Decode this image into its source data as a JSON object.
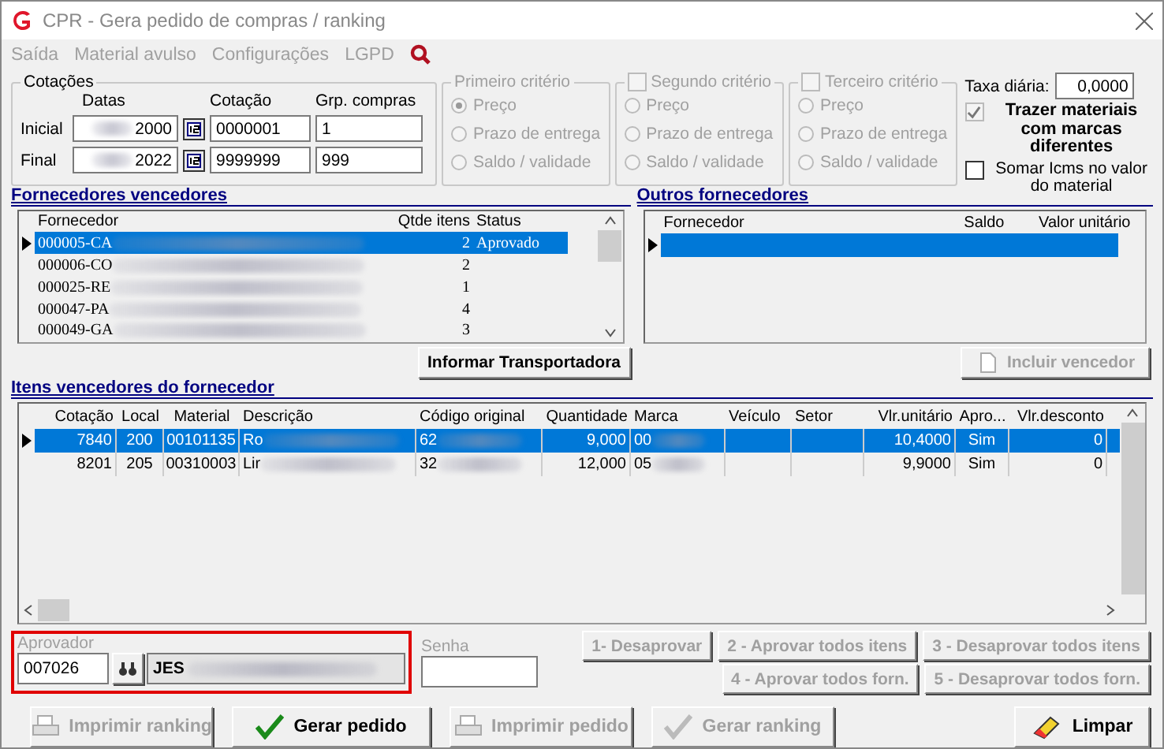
{
  "window": {
    "title": "CPR - Gera pedido de compras / ranking"
  },
  "menu": [
    {
      "label": "Saída",
      "disabled": true
    },
    {
      "label": "Material avulso",
      "disabled": true
    },
    {
      "label": "Configurações",
      "disabled": true
    },
    {
      "label": "LGPD",
      "disabled": true
    }
  ],
  "cotacoes": {
    "title": "Cotações",
    "headers": [
      "Datas",
      "Cotação",
      "Grp. compras"
    ],
    "rows": [
      {
        "label": "Inicial",
        "date": "2000",
        "cotacao": "0000001",
        "grupo": "1"
      },
      {
        "label": "Final",
        "date": "2022",
        "cotacao": "9999999",
        "grupo": "999"
      }
    ]
  },
  "criteria": [
    {
      "kind": "plain",
      "title": "Primeiro critério",
      "options": [
        {
          "label": "Preço",
          "selected": true
        },
        {
          "label": "Prazo de entrega",
          "selected": false
        },
        {
          "label": "Saldo / validade",
          "selected": false
        }
      ]
    },
    {
      "kind": "checkbox",
      "title": "Segundo critério",
      "checked": false,
      "options": [
        {
          "label": "Preço",
          "selected": false
        },
        {
          "label": "Prazo de entrega",
          "selected": false
        },
        {
          "label": "Saldo / validade",
          "selected": false
        }
      ]
    },
    {
      "kind": "checkbox",
      "title": "Terceiro critério",
      "checked": false,
      "options": [
        {
          "label": "Preço",
          "selected": false
        },
        {
          "label": "Prazo de entrega",
          "selected": false
        },
        {
          "label": "Saldo / validade",
          "selected": false
        }
      ]
    }
  ],
  "taxa": {
    "label": "Taxa diária:",
    "value": "0,0000"
  },
  "options": [
    {
      "label": "Trazer materiais com marcas diferentes",
      "checked": true,
      "disabled": true
    },
    {
      "label": "Somar Icms no valor do material",
      "checked": false,
      "disabled": false
    }
  ],
  "winners": {
    "title": "Fornecedores vencedores",
    "columns": [
      "Fornecedor",
      "Qtde itens",
      "Status"
    ],
    "rows": [
      {
        "fornecedor": "000005-CA",
        "qtde": "2",
        "status": "Aprovado",
        "selected": true
      },
      {
        "fornecedor": "000006-CO",
        "qtde": "2",
        "selected": false
      },
      {
        "fornecedor": "000025-RE",
        "qtde": "1",
        "selected": false
      },
      {
        "fornecedor": "000047-PA",
        "qtde": "4",
        "selected": false
      },
      {
        "fornecedor": "000049-GA",
        "qtde": "3",
        "selected": false
      }
    ]
  },
  "others": {
    "title": "Outros fornecedores",
    "columns": [
      "Fornecedor",
      "Saldo",
      "Valor unitário"
    ],
    "rows": [
      {
        "selected": true
      }
    ]
  },
  "transport_button": {
    "label": "Informar Transportadora",
    "disabled": false
  },
  "include_button": {
    "label": "Incluir vencedor",
    "disabled": true
  },
  "items": {
    "title": "Itens vencedores do fornecedor",
    "columns": [
      "Cotação",
      "Local",
      "Material",
      "Descrição",
      "Código original",
      "Quantidade",
      "Marca",
      "Veículo",
      "Setor",
      "Vlr.unitário",
      "Apro...",
      "Vlr.desconto"
    ],
    "rows": [
      {
        "cells": [
          "7840",
          "200",
          "00101135",
          "Ro",
          "62",
          "9,000",
          "00",
          "",
          "",
          "10,4000",
          "Sim",
          "0"
        ],
        "selected": true
      },
      {
        "cells": [
          "8201",
          "205",
          "00310003",
          "Lir",
          "32",
          "12,000",
          "05",
          "",
          "",
          "9,9000",
          "Sim",
          "0"
        ],
        "selected": false
      }
    ]
  },
  "approver": {
    "label": "Aprovador",
    "code": "007026",
    "name": "JES",
    "highlighted": true
  },
  "password": {
    "label": "Senha"
  },
  "action_buttons": [
    [
      {
        "label": "1- Desaprovar",
        "disabled": true
      },
      {
        "label": "2 - Aprovar todos itens",
        "disabled": true
      },
      {
        "label": "3 - Desaprovar todos itens",
        "disabled": true
      }
    ],
    [
      {
        "label": "4 - Aprovar todos forn.",
        "disabled": true
      },
      {
        "label": "5 - Desaprovar todos forn.",
        "disabled": true
      }
    ]
  ],
  "footer_buttons": [
    {
      "label": "Imprimir ranking",
      "kind": "print",
      "disabled": true
    },
    {
      "label": "Gerar pedido",
      "kind": "confirm",
      "disabled": false
    },
    {
      "label": "Imprimir pedido",
      "kind": "print",
      "disabled": true
    },
    {
      "label": "Gerar ranking",
      "kind": "confirm",
      "disabled": true
    },
    {
      "label": "Limpar",
      "kind": "clear",
      "disabled": false
    }
  ]
}
